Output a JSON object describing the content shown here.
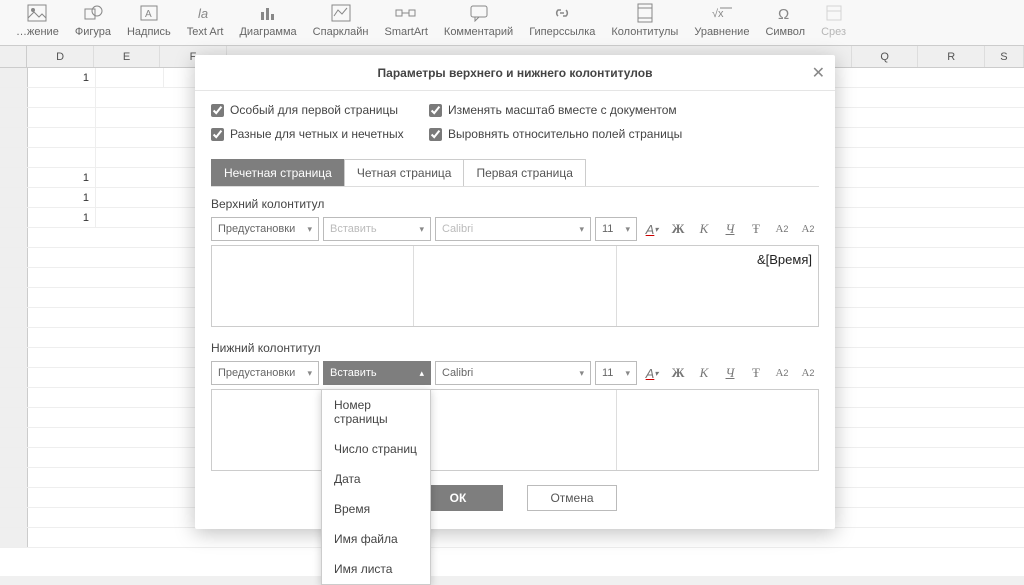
{
  "ribbon": [
    {
      "label": "…жение",
      "dim": false
    },
    {
      "label": "Фигура",
      "dim": false
    },
    {
      "label": "Надпись",
      "dim": false
    },
    {
      "label": "Text Art",
      "dim": false
    },
    {
      "label": "Диаграмма",
      "dim": false
    },
    {
      "label": "Спарклайн",
      "dim": false
    },
    {
      "label": "SmartArt",
      "dim": false
    },
    {
      "label": "Комментарий",
      "dim": false
    },
    {
      "label": "Гиперссылка",
      "dim": false
    },
    {
      "label": "Колонтитулы",
      "dim": false
    },
    {
      "label": "Уравнение",
      "dim": false
    },
    {
      "label": "Символ",
      "dim": false
    },
    {
      "label": "Срез",
      "dim": true
    }
  ],
  "columns": [
    "D",
    "E",
    "F",
    "",
    "",
    "",
    "",
    "",
    "",
    "",
    "",
    "Q",
    "R",
    "S"
  ],
  "cells": {
    "r1c0": "1",
    "r5c0": "1",
    "r6c0": "1",
    "r7c0": "1"
  },
  "modal": {
    "title": "Параметры верхнего и нижнего колонтитулов",
    "checks": {
      "c1": "Особый для первой страницы",
      "c2": "Изменять масштаб вместе с документом",
      "c3": "Разные для четных и нечетных",
      "c4": "Выровнять относительно полей страницы"
    },
    "tabs": [
      "Нечетная страница",
      "Четная страница",
      "Первая страница"
    ],
    "section_header": "Верхний колонтитул",
    "section_footer": "Нижний колонтитул",
    "presets": "Предустановки",
    "insert": "Вставить",
    "font": "Calibri",
    "size": "11",
    "header_right": "&[Время]",
    "ok": "ОК",
    "cancel": "Отмена",
    "insert_menu": [
      "Номер страницы",
      "Число страниц",
      "Дата",
      "Время",
      "Имя файла",
      "Имя листа"
    ]
  }
}
